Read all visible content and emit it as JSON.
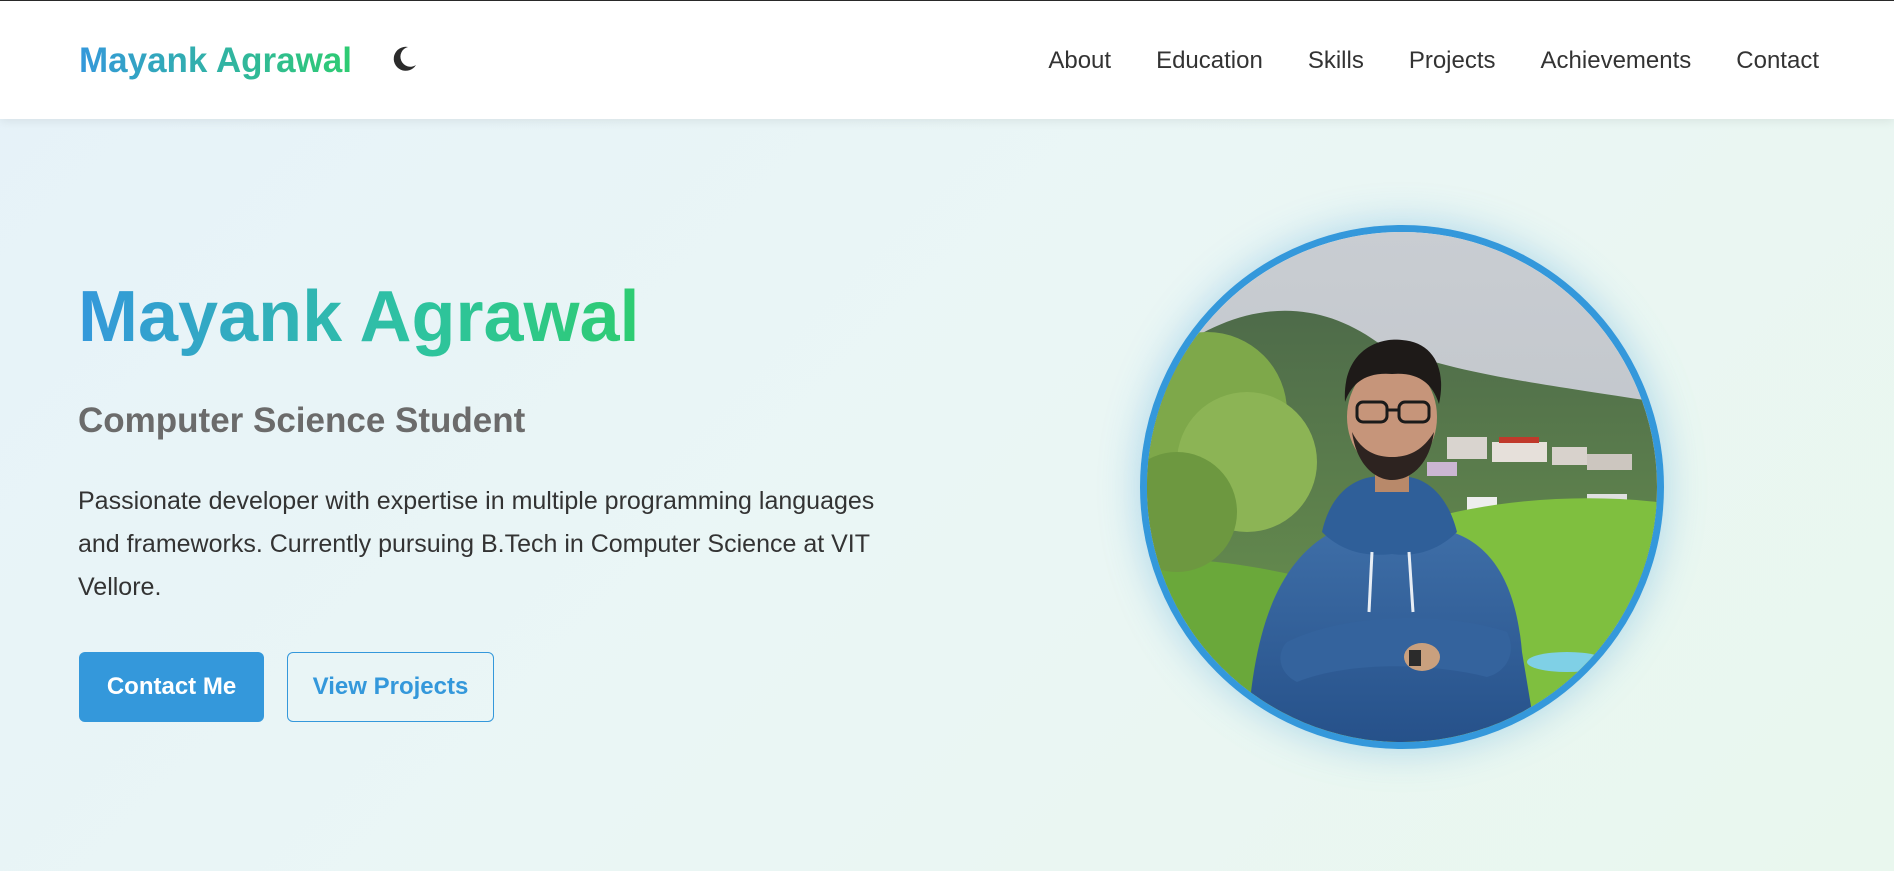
{
  "header": {
    "brand": "Mayank Agrawal",
    "theme_toggle_icon": "moon-icon",
    "nav": [
      "About",
      "Education",
      "Skills",
      "Projects",
      "Achievements",
      "Contact"
    ]
  },
  "hero": {
    "name": "Mayank Agrawal",
    "role": "Computer Science Student",
    "description": "Passionate developer with expertise in multiple programming languages and frameworks. Currently pursuing B.Tech in Computer Science at VIT Vellore.",
    "primary_button": "Contact Me",
    "secondary_button": "View Projects"
  },
  "colors": {
    "accent": "#3498db",
    "accent_green": "#2ecc71",
    "role_text": "#6b6b6b"
  }
}
